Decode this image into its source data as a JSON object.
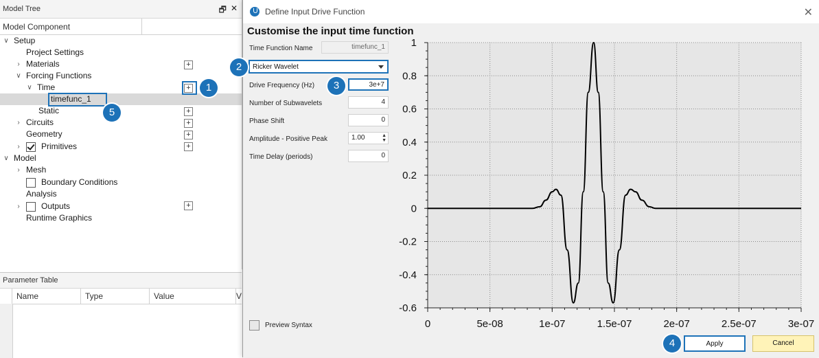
{
  "model_tree": {
    "title": "Model Tree",
    "column_header": "Model Component",
    "items": [
      {
        "label": "Setup"
      },
      {
        "label": "Project Settings"
      },
      {
        "label": "Materials"
      },
      {
        "label": "Forcing Functions"
      },
      {
        "label": "Time"
      },
      {
        "label": "timefunc_1"
      },
      {
        "label": "Static"
      },
      {
        "label": "Circuits"
      },
      {
        "label": "Geometry"
      },
      {
        "label": "Primitives"
      },
      {
        "label": "Model"
      },
      {
        "label": "Mesh"
      },
      {
        "label": "Boundary Conditions"
      },
      {
        "label": "Analysis"
      },
      {
        "label": "Outputs"
      },
      {
        "label": "Runtime Graphics"
      }
    ]
  },
  "parameter_table": {
    "title": "Parameter Table",
    "columns": [
      "Name",
      "Type",
      "Value",
      "V"
    ]
  },
  "dialog": {
    "title": "Define Input Drive Function",
    "heading": "Customise the input time function",
    "fields": {
      "time_function_name_label": "Time Function Name",
      "time_function_name_value": "timefunc_1",
      "function_type": "Ricker Wavelet",
      "drive_frequency_label": "Drive Frequency (Hz)",
      "drive_frequency_value": "3e+7",
      "subwavelets_label": "Number of Subwavelets",
      "subwavelets_value": "4",
      "phase_shift_label": "Phase Shift",
      "phase_shift_value": "0",
      "amplitude_label": "Amplitude - Positive Peak",
      "amplitude_value": "1.00",
      "time_delay_label": "Time Delay (periods)",
      "time_delay_value": "0"
    },
    "preview_label": "Preview Syntax",
    "apply_label": "Apply",
    "cancel_label": "Cancel"
  },
  "callouts": [
    "1",
    "2",
    "3",
    "4",
    "5"
  ],
  "colors": {
    "accent": "#1d72b8",
    "cancel_bg": "#fff3b8",
    "plot_bg": "#e6e6e6"
  },
  "chart_data": {
    "type": "line",
    "title": "",
    "xlabel": "",
    "ylabel": "",
    "xlim": [
      0,
      3e-07
    ],
    "ylim": [
      -0.6,
      1.0
    ],
    "x_ticks": [
      "0",
      "5e-08",
      "1e-07",
      "1.5e-07",
      "2e-07",
      "2.5e-07",
      "3e-07"
    ],
    "y_ticks": [
      "1",
      "0.8",
      "0.6",
      "0.4",
      "0.2",
      "0",
      "-0.2",
      "-0.4",
      "-0.6"
    ],
    "grid": true,
    "series": [
      {
        "x": [
          0,
          8.4e-08,
          9e-08,
          9.5e-08,
          1e-07,
          1.03e-07,
          1.07e-07,
          1.12e-07,
          1.17e-07,
          1.21e-07,
          1.25e-07,
          1.29e-07,
          1.333e-07,
          1.37e-07,
          1.41e-07,
          1.45e-07,
          1.49e-07,
          1.54e-07,
          1.59e-07,
          1.63e-07,
          1.67e-07,
          1.72e-07,
          1.78e-07,
          1.83e-07,
          3e-07
        ],
        "y": [
          0,
          0,
          0.01,
          0.05,
          0.1,
          0.115,
          0.08,
          -0.25,
          -0.57,
          -0.45,
          0.1,
          0.7,
          1.0,
          0.7,
          0.1,
          -0.45,
          -0.57,
          -0.25,
          0.08,
          0.115,
          0.1,
          0.05,
          0.01,
          0,
          0
        ]
      }
    ]
  }
}
